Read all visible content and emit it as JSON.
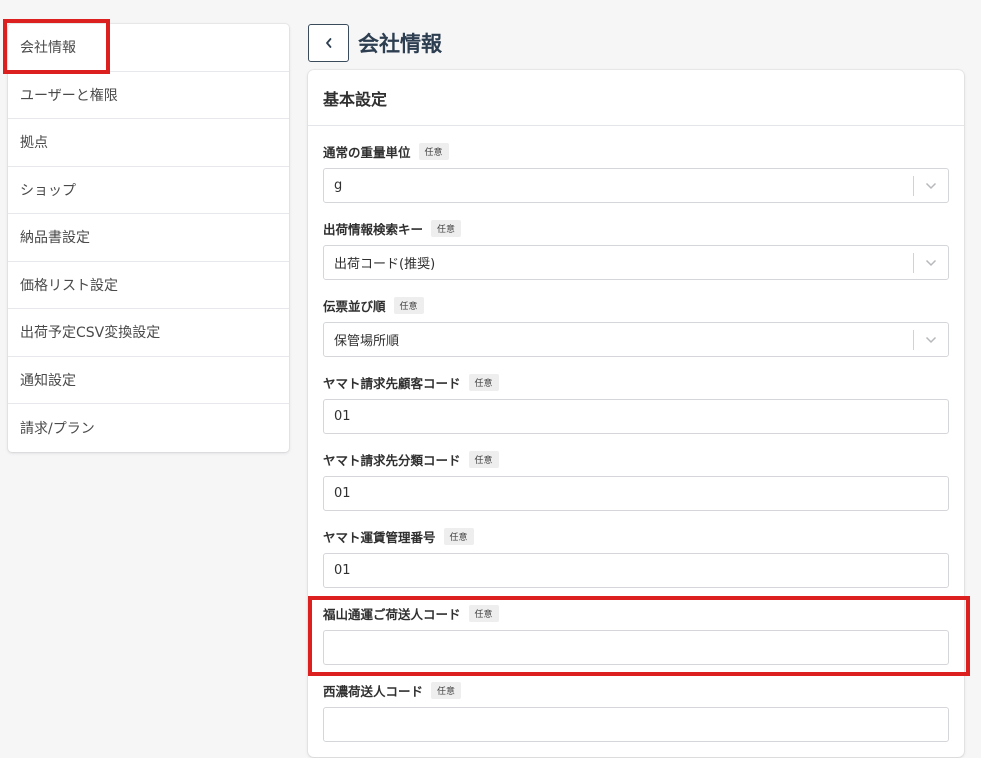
{
  "sidebar": {
    "items": [
      {
        "label": "会社情報"
      },
      {
        "label": "ユーザーと権限"
      },
      {
        "label": "拠点"
      },
      {
        "label": "ショップ"
      },
      {
        "label": "納品書設定"
      },
      {
        "label": "価格リスト設定"
      },
      {
        "label": "出荷予定CSV変換設定"
      },
      {
        "label": "通知設定"
      },
      {
        "label": "請求/プラン"
      }
    ]
  },
  "header": {
    "title": "会社情報",
    "back_icon": "chevron-left-icon"
  },
  "card": {
    "title": "基本設定",
    "optional_badge": "任意",
    "fields": {
      "weight_unit": {
        "label": "通常の重量単位",
        "value": "g"
      },
      "shipment_search_key": {
        "label": "出荷情報検索キー",
        "value": "出荷コード(推奨)"
      },
      "slip_order": {
        "label": "伝票並び順",
        "value": "保管場所順"
      },
      "yamato_customer_code": {
        "label": "ヤマト請求先顧客コード",
        "value": "01"
      },
      "yamato_class_code": {
        "label": "ヤマト請求先分類コード",
        "value": "01"
      },
      "yamato_freight_number": {
        "label": "ヤマト運賃管理番号",
        "value": "01"
      },
      "fukuyama_sender_code": {
        "label": "福山通運ご荷送人コード",
        "value": ""
      },
      "seino_sender_code": {
        "label": "西濃荷送人コード",
        "value": ""
      }
    }
  },
  "colors": {
    "highlight": "#dc2020",
    "title": "#2c3e50",
    "background": "#f6f6f7"
  }
}
